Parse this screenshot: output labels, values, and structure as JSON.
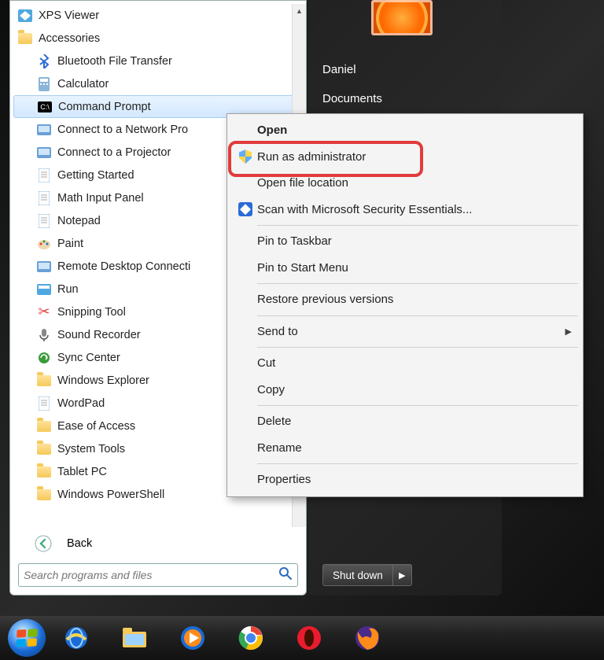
{
  "startMenu": {
    "programs": [
      {
        "icon": "xps-icon",
        "label": "XPS Viewer",
        "indent": false
      },
      {
        "icon": "folder-icon",
        "label": "Accessories",
        "indent": false
      },
      {
        "icon": "bluetooth-icon",
        "label": "Bluetooth File Transfer",
        "indent": true
      },
      {
        "icon": "calculator-icon",
        "label": "Calculator",
        "indent": true
      },
      {
        "icon": "cmd-icon",
        "label": "Command Prompt",
        "indent": true,
        "selected": true
      },
      {
        "icon": "network-icon",
        "label": "Connect to a Network Pro",
        "indent": true
      },
      {
        "icon": "projector-icon",
        "label": "Connect to a Projector",
        "indent": true
      },
      {
        "icon": "getting-started-icon",
        "label": "Getting Started",
        "indent": true
      },
      {
        "icon": "math-input-icon",
        "label": "Math Input Panel",
        "indent": true
      },
      {
        "icon": "notepad-icon",
        "label": "Notepad",
        "indent": true
      },
      {
        "icon": "paint-icon",
        "label": "Paint",
        "indent": true
      },
      {
        "icon": "rdp-icon",
        "label": "Remote Desktop Connecti",
        "indent": true
      },
      {
        "icon": "run-icon",
        "label": "Run",
        "indent": true
      },
      {
        "icon": "snipping-icon",
        "label": "Snipping Tool",
        "indent": true
      },
      {
        "icon": "sound-recorder-icon",
        "label": "Sound Recorder",
        "indent": true
      },
      {
        "icon": "sync-center-icon",
        "label": "Sync Center",
        "indent": true
      },
      {
        "icon": "explorer-icon",
        "label": "Windows Explorer",
        "indent": true
      },
      {
        "icon": "wordpad-icon",
        "label": "WordPad",
        "indent": true
      },
      {
        "icon": "folder-icon",
        "label": "Ease of Access",
        "indent": true
      },
      {
        "icon": "folder-icon",
        "label": "System Tools",
        "indent": true
      },
      {
        "icon": "folder-icon",
        "label": "Tablet PC",
        "indent": true
      },
      {
        "icon": "folder-icon",
        "label": "Windows PowerShell",
        "indent": true
      }
    ],
    "back": "Back",
    "searchPlaceholder": "Search programs and files"
  },
  "rightPanel": {
    "items": [
      "Daniel",
      "Documents"
    ],
    "shutdown": "Shut down"
  },
  "contextMenu": {
    "items": [
      {
        "label": "Open",
        "bold": true
      },
      {
        "label": "Run as administrator",
        "icon": "shield-icon",
        "highlighted": true
      },
      {
        "label": "Open file location"
      },
      {
        "label": "Scan with Microsoft Security Essentials...",
        "icon": "mse-icon"
      },
      {
        "sep": true
      },
      {
        "label": "Pin to Taskbar"
      },
      {
        "label": "Pin to Start Menu"
      },
      {
        "sep": true
      },
      {
        "label": "Restore previous versions"
      },
      {
        "sep": true
      },
      {
        "label": "Send to",
        "submenu": true
      },
      {
        "sep": true
      },
      {
        "label": "Cut"
      },
      {
        "label": "Copy"
      },
      {
        "sep": true
      },
      {
        "label": "Delete"
      },
      {
        "label": "Rename"
      },
      {
        "sep": true
      },
      {
        "label": "Properties"
      }
    ]
  },
  "taskbar": {
    "items": [
      {
        "name": "start-button"
      },
      {
        "name": "ie-icon"
      },
      {
        "name": "explorer-icon"
      },
      {
        "name": "media-player-icon"
      },
      {
        "name": "chrome-icon"
      },
      {
        "name": "opera-icon"
      },
      {
        "name": "firefox-icon"
      }
    ]
  },
  "iconGlyphs": {
    "xps-icon": "📄",
    "folder-icon": "FOLDER",
    "bluetooth-icon": "ᛒ",
    "calculator-icon": "🖩",
    "cmd-icon": "CMD",
    "network-icon": "🖥",
    "projector-icon": "📽",
    "getting-started-icon": "📘",
    "math-input-icon": "✎",
    "notepad-icon": "📄",
    "paint-icon": "🎨",
    "rdp-icon": "🖥",
    "run-icon": "▶",
    "snipping-icon": "✂",
    "sound-recorder-icon": "🎙",
    "sync-center-icon": "🔄",
    "explorer-icon": "📁",
    "wordpad-icon": "📝"
  }
}
